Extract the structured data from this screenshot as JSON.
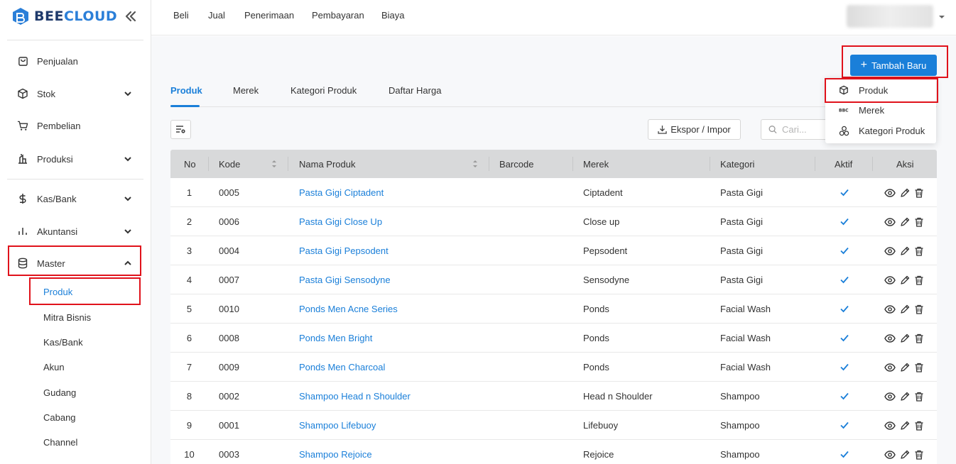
{
  "app": {
    "logo_text_a": "BEE",
    "logo_text_b": "CLOUD",
    "colors": {
      "brand": "#1a7fd9",
      "logo_dark": "#1f3a6b",
      "highlight": "#e0121b"
    }
  },
  "sidebar": {
    "items": [
      {
        "label": "Penjualan",
        "icon": "shopping-bag-icon"
      },
      {
        "label": "Stok",
        "icon": "box-icon"
      },
      {
        "label": "Pembelian",
        "icon": "cart-icon"
      },
      {
        "label": "Produksi",
        "icon": "factory-icon"
      },
      {
        "label": "Kas/Bank",
        "icon": "dollar-icon"
      },
      {
        "label": "Akuntansi",
        "icon": "bar-chart-icon"
      },
      {
        "label": "Master",
        "icon": "database-icon"
      }
    ],
    "master_sub": [
      "Produk",
      "Mitra Bisnis",
      "Kas/Bank",
      "Akun",
      "Gudang",
      "Cabang",
      "Channel"
    ]
  },
  "topnav": {
    "items": [
      "Beli",
      "Jual",
      "Penerimaan",
      "Pembayaran",
      "Biaya"
    ]
  },
  "toolbar": {
    "add_label": "Tambah Baru",
    "export_label": "Ekspor / Impor",
    "search_placeholder": "Cari..."
  },
  "dropdown": {
    "items": [
      {
        "label": "Produk",
        "icon": "cube-icon"
      },
      {
        "label": "Merek",
        "icon": "brand-icon"
      },
      {
        "label": "Kategori Produk",
        "icon": "category-icon"
      }
    ]
  },
  "tabs": [
    "Produk",
    "Merek",
    "Kategori Produk",
    "Daftar Harga"
  ],
  "table": {
    "headers": [
      "No",
      "Kode",
      "Nama Produk",
      "Barcode",
      "Merek",
      "Kategori",
      "Aktif",
      "Aksi"
    ],
    "rows": [
      {
        "no": "1",
        "kode": "0005",
        "nama": "Pasta Gigi Ciptadent",
        "barcode": "",
        "merek": "Ciptadent",
        "kategori": "Pasta Gigi",
        "aktif": true
      },
      {
        "no": "2",
        "kode": "0006",
        "nama": "Pasta Gigi Close Up",
        "barcode": "",
        "merek": "Close up",
        "kategori": "Pasta Gigi",
        "aktif": true
      },
      {
        "no": "3",
        "kode": "0004",
        "nama": "Pasta Gigi Pepsodent",
        "barcode": "",
        "merek": "Pepsodent",
        "kategori": "Pasta Gigi",
        "aktif": true
      },
      {
        "no": "4",
        "kode": "0007",
        "nama": "Pasta Gigi Sensodyne",
        "barcode": "",
        "merek": "Sensodyne",
        "kategori": "Pasta Gigi",
        "aktif": true
      },
      {
        "no": "5",
        "kode": "0010",
        "nama": "Ponds Men Acne Series",
        "barcode": "",
        "merek": "Ponds",
        "kategori": "Facial Wash",
        "aktif": true
      },
      {
        "no": "6",
        "kode": "0008",
        "nama": "Ponds Men Bright",
        "barcode": "",
        "merek": "Ponds",
        "kategori": "Facial Wash",
        "aktif": true
      },
      {
        "no": "7",
        "kode": "0009",
        "nama": "Ponds Men Charcoal",
        "barcode": "",
        "merek": "Ponds",
        "kategori": "Facial Wash",
        "aktif": true
      },
      {
        "no": "8",
        "kode": "0002",
        "nama": "Shampoo Head n Shoulder",
        "barcode": "",
        "merek": "Head n Shoulder",
        "kategori": "Shampoo",
        "aktif": true
      },
      {
        "no": "9",
        "kode": "0001",
        "nama": "Shampoo Lifebuoy",
        "barcode": "",
        "merek": "Lifebuoy",
        "kategori": "Shampoo",
        "aktif": true
      },
      {
        "no": "10",
        "kode": "0003",
        "nama": "Shampoo Rejoice",
        "barcode": "",
        "merek": "Rejoice",
        "kategori": "Shampoo",
        "aktif": true
      }
    ]
  }
}
